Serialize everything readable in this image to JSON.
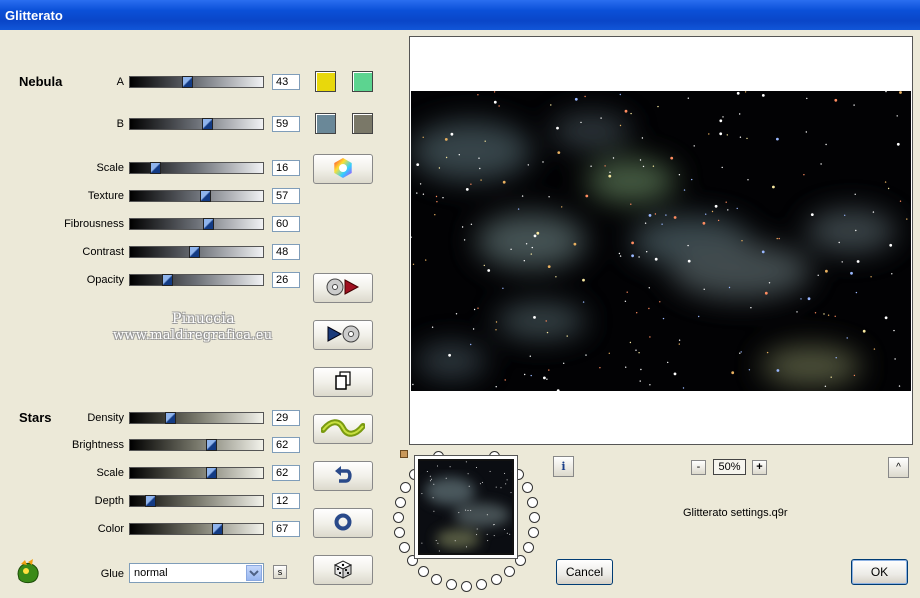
{
  "window": {
    "title": "Glitterato"
  },
  "nebula": {
    "label": "Nebula",
    "a": {
      "label": "A",
      "value": "43"
    },
    "b": {
      "label": "B",
      "value": "59"
    },
    "colors": {
      "a_primary": "#e8d80c",
      "a_secondary": "#5cd490",
      "b_primary": "#6a8898",
      "b_secondary": "#7a7868"
    },
    "sliders": [
      {
        "label": "Scale",
        "value": "16"
      },
      {
        "label": "Texture",
        "value": "57"
      },
      {
        "label": "Fibrousness",
        "value": "60"
      },
      {
        "label": "Contrast",
        "value": "48"
      },
      {
        "label": "Opacity",
        "value": "26"
      }
    ]
  },
  "watermark": {
    "line1": "Pinuccia",
    "line2": "www.maldiregrafica.eu"
  },
  "stars": {
    "label": "Stars",
    "sliders": [
      {
        "label": "Density",
        "value": "29"
      },
      {
        "label": "Brightness",
        "value": "62"
      },
      {
        "label": "Scale",
        "value": "62"
      },
      {
        "label": "Depth",
        "value": "12"
      },
      {
        "label": "Color",
        "value": "67"
      }
    ]
  },
  "glue": {
    "label": "Glue",
    "value": "normal"
  },
  "zoom": {
    "value": "50%",
    "minus": "-",
    "plus": "+"
  },
  "settings_file": "Glitterato settings.q9r",
  "buttons": {
    "cancel": "Cancel",
    "ok": "OK",
    "info": "i",
    "collapse": "^",
    "s": "s"
  }
}
